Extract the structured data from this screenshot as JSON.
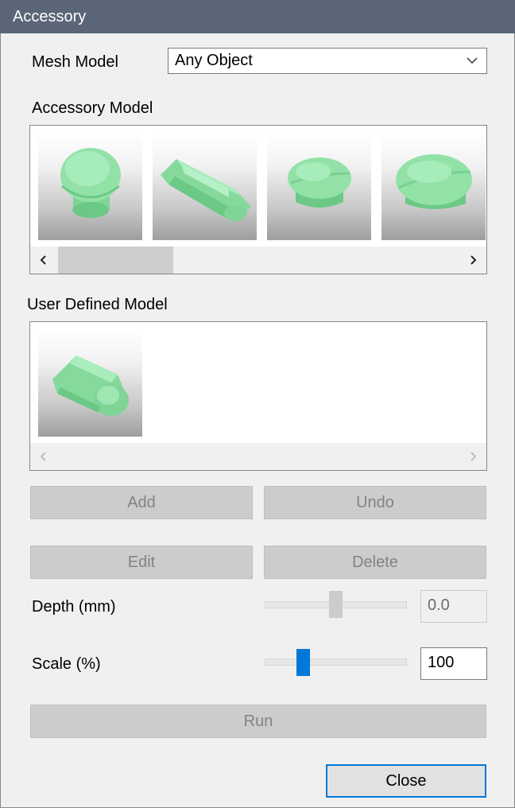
{
  "window": {
    "title": "Accessory"
  },
  "mesh_model": {
    "label": "Mesh Model",
    "selected": "Any Object"
  },
  "accessory_model": {
    "label": "Accessory Model",
    "items": [
      {
        "shape": "round-cap"
      },
      {
        "shape": "handle-bar"
      },
      {
        "shape": "split-round-cap"
      },
      {
        "shape": "split-oval-cap"
      }
    ],
    "scroll_position": 0.0
  },
  "user_defined_model": {
    "label": "User Defined Model",
    "items": [
      {
        "shape": "rounded-block"
      }
    ]
  },
  "buttons": {
    "add": "Add",
    "undo": "Undo",
    "edit": "Edit",
    "delete": "Delete",
    "run": "Run",
    "close": "Close"
  },
  "depth": {
    "label": "Depth (mm)",
    "value": "0.0",
    "slider_fraction": 0.5,
    "enabled": false
  },
  "scale": {
    "label": "Scale (%)",
    "value": "100",
    "slider_fraction": 0.25,
    "enabled": true
  },
  "colors": {
    "titlebar": "#5a6578",
    "model_green": "#8fdca4",
    "accent": "#0078d7",
    "disabled_text": "#838383"
  },
  "icons": {
    "dropdown": "chevron-down-icon",
    "scroll_left": "chevron-left-icon",
    "scroll_right": "chevron-right-icon"
  }
}
